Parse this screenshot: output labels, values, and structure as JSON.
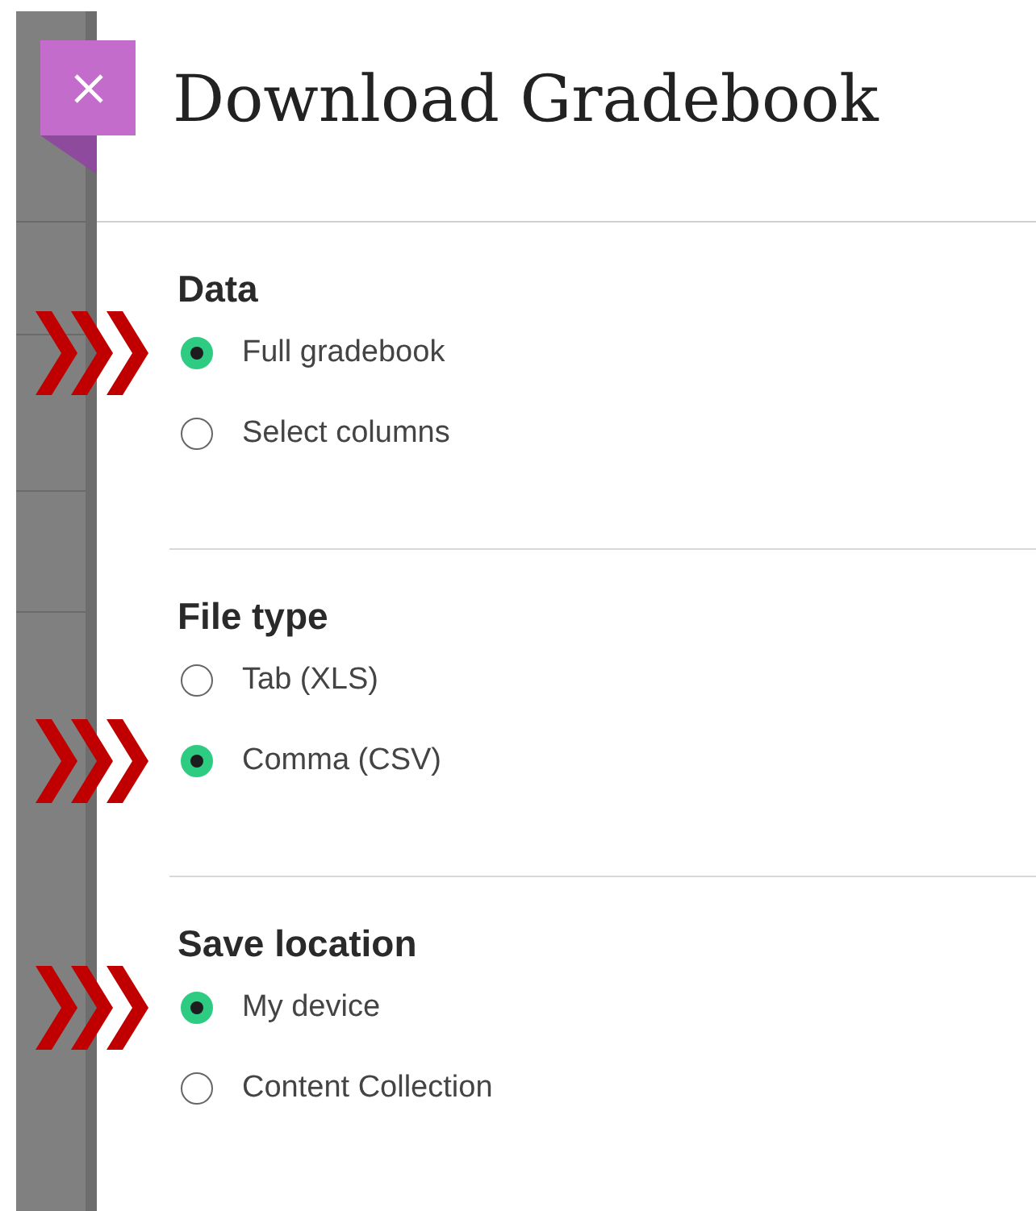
{
  "panel": {
    "title": "Download Gradebook"
  },
  "sections": [
    {
      "heading": "Data",
      "options": [
        {
          "label": "Full gradebook",
          "selected": true
        },
        {
          "label": "Select columns",
          "selected": false
        }
      ]
    },
    {
      "heading": "File type",
      "options": [
        {
          "label": "Tab (XLS)",
          "selected": false
        },
        {
          "label": "Comma (CSV)",
          "selected": true
        }
      ]
    },
    {
      "heading": "Save location",
      "options": [
        {
          "label": "My device",
          "selected": true
        },
        {
          "label": "Content Collection",
          "selected": false
        }
      ]
    }
  ]
}
